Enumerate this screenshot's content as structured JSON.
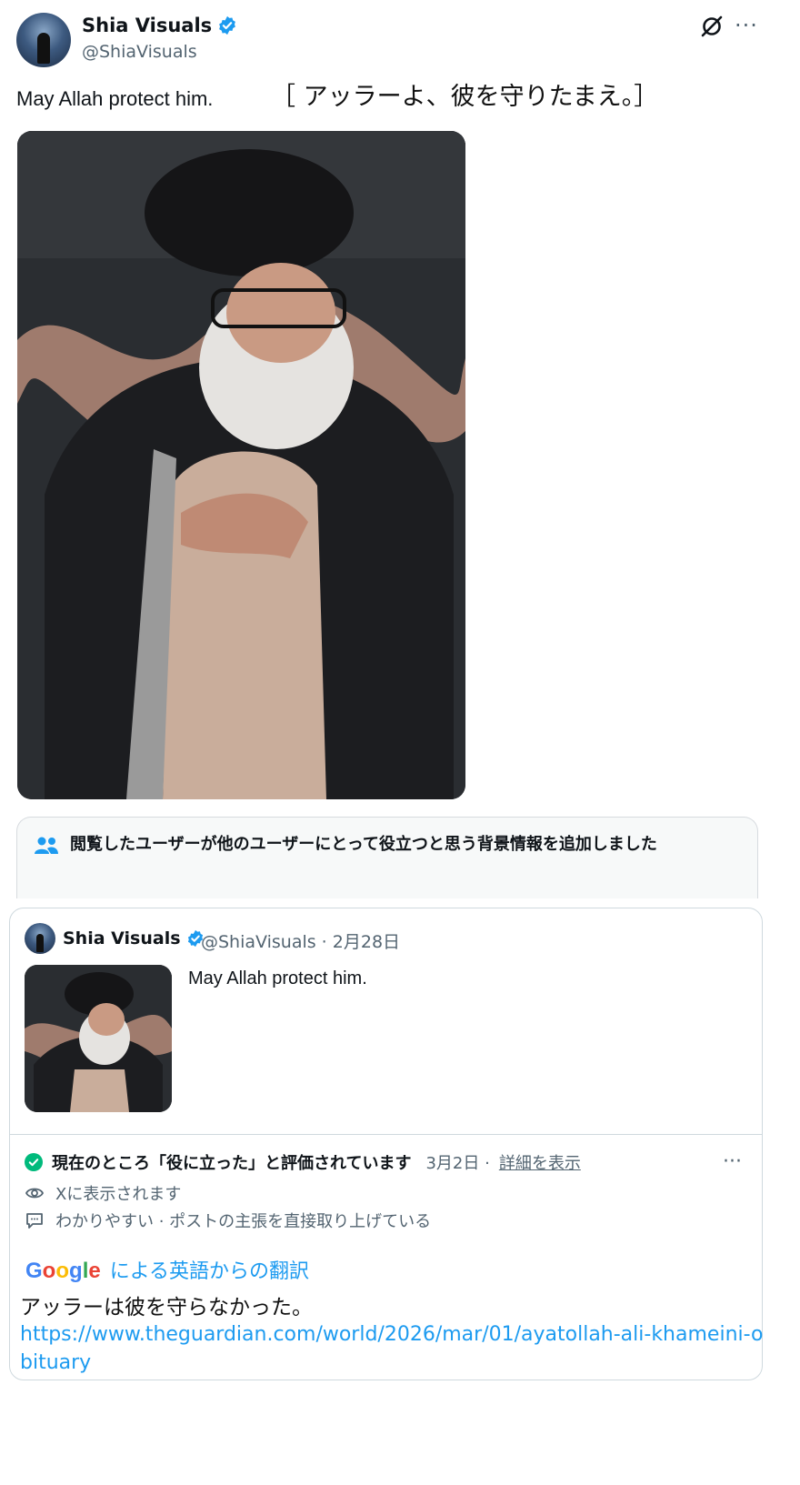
{
  "post": {
    "author_name": "Shia Visuals",
    "handle": "@ShiaVisuals",
    "text": "May Allah protect him.",
    "translation_note": "［ アッラーよ、彼を守りたまえ。］",
    "more_label": "···"
  },
  "community_note": {
    "header": "閲覧したユーザーが他のユーザーにとって役立つと思う背景情報を追加しました",
    "quoted": {
      "author_name": "Shia Visuals",
      "meta": "@ShiaVisuals · 2月28日",
      "text": "May Allah protect him."
    },
    "status_label": "現在のところ「役に立った」と評価されています",
    "status_date": "3月2日 ·",
    "details_link": "詳細を表示",
    "more_label": "···",
    "visibility": "Xに表示されます",
    "reasons": "わかりやすい · ポストの主張を直接取り上げている"
  },
  "translation": {
    "google_letters": [
      "G",
      "o",
      "o",
      "g",
      "l",
      "e"
    ],
    "via_label": "による英語からの翻訳",
    "text": "アッラーは彼を守らなかった。",
    "url": "https://www.theguardian.com/world/2026/mar/01/ayatollah-ali-khameini-obituary"
  },
  "colors": {
    "verified": "#1d9bf0",
    "helpful": "#00ba7c",
    "link": "#1d9bf0",
    "muted": "#536471"
  },
  "icons": [
    "verified-badge-icon",
    "grok-icon",
    "more-icon",
    "people-icon",
    "check-circle-icon",
    "eye-icon",
    "comment-icon"
  ]
}
